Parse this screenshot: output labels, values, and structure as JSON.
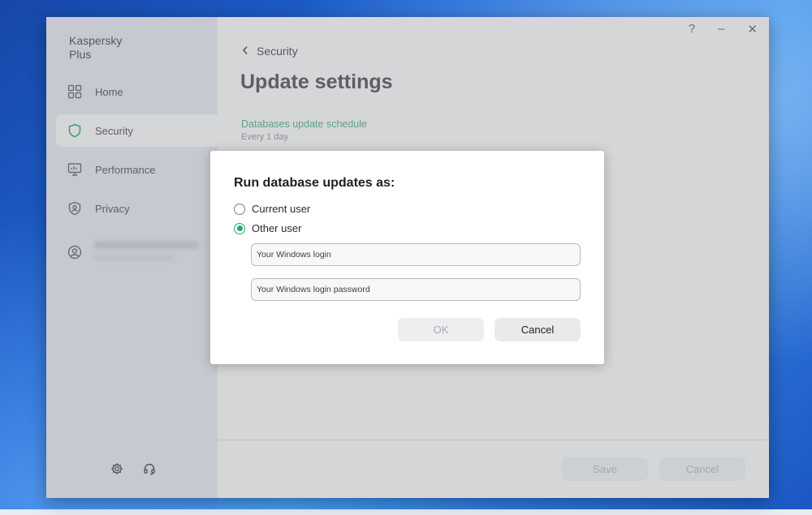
{
  "app": {
    "brand_line1": "Kaspersky",
    "brand_line2": "Plus"
  },
  "sidebar": {
    "items": [
      {
        "label": "Home",
        "icon": "home-grid-icon"
      },
      {
        "label": "Security",
        "icon": "shield-icon",
        "active": true
      },
      {
        "label": "Performance",
        "icon": "monitor-icon"
      },
      {
        "label": "Privacy",
        "icon": "privacy-shield-icon"
      }
    ],
    "bottom_icons": [
      "gear-icon",
      "headset-icon"
    ]
  },
  "window_controls": {
    "help": "?",
    "minimize": "–",
    "close": "✕"
  },
  "page": {
    "back_label": "Security",
    "title": "Update settings",
    "schedule_link": "Databases update schedule",
    "schedule_value": "Every 1 day",
    "save_label": "Save",
    "cancel_label": "Cancel"
  },
  "dialog": {
    "title": "Run database updates as:",
    "options": [
      {
        "label": "Current user",
        "checked": false
      },
      {
        "label": "Other user",
        "checked": true
      }
    ],
    "login_placeholder": "Your Windows login",
    "password_placeholder": "Your Windows login password",
    "ok_label": "OK",
    "cancel_label": "Cancel"
  },
  "colors": {
    "accent_green": "#2aa86d",
    "link_teal": "#5fa08b"
  }
}
